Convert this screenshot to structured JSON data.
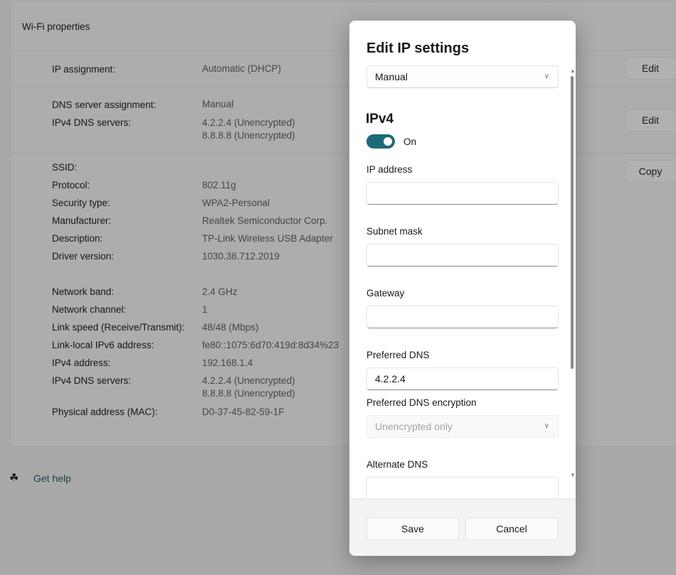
{
  "background": {
    "section_title": "Wi-Fi properties",
    "ip_assignment": {
      "label": "IP assignment:",
      "value": "Automatic (DHCP)",
      "button": "Edit"
    },
    "dns_assignment": {
      "label": "DNS server assignment:",
      "value": "Manual",
      "servers_label": "IPv4 DNS servers:",
      "servers": [
        "4.2.2.4 (Unencrypted)",
        "8.8.8.8 (Unencrypted)"
      ],
      "button": "Edit"
    },
    "copy_button": "Copy",
    "properties": [
      {
        "label": "SSID:",
        "value": ""
      },
      {
        "label": "Protocol:",
        "value": "802.11g"
      },
      {
        "label": "Security type:",
        "value": "WPA2-Personal"
      },
      {
        "label": "Manufacturer:",
        "value": "Realtek Semiconductor Corp."
      },
      {
        "label": "Description:",
        "value": "TP-Link Wireless USB Adapter"
      },
      {
        "label": "Driver version:",
        "value": "1030.38.712.2019"
      },
      {
        "label": "Network band:",
        "value": "2.4 GHz"
      },
      {
        "label": "Network channel:",
        "value": "1"
      },
      {
        "label": "Link speed (Receive/Transmit):",
        "value": "48/48 (Mbps)"
      },
      {
        "label": "Link-local IPv6 address:",
        "value": "fe80::1075:6d70:419d:8d34%23"
      },
      {
        "label": "IPv4 address:",
        "value": "192.168.1.4"
      },
      {
        "label": "IPv4 DNS servers:",
        "value": "4.2.2.4 (Unencrypted)",
        "value2": "8.8.8.8 (Unencrypted)"
      },
      {
        "label": "Physical address (MAC):",
        "value": "D0-37-45-82-59-1F"
      }
    ],
    "get_help": "Get help"
  },
  "dialog": {
    "title": "Edit IP settings",
    "mode_select": "Manual",
    "ipv4_heading": "IPv4",
    "ipv4_toggle": {
      "state": "On",
      "on": true,
      "color": "#1e6a78"
    },
    "fields": {
      "ip_address": {
        "label": "IP address",
        "value": ""
      },
      "subnet_mask": {
        "label": "Subnet mask",
        "value": ""
      },
      "gateway": {
        "label": "Gateway",
        "value": ""
      },
      "preferred_dns": {
        "label": "Preferred DNS",
        "value": "4.2.2.4"
      },
      "preferred_dns_encryption": {
        "label": "Preferred DNS encryption",
        "value": "Unencrypted only"
      },
      "alternate_dns": {
        "label": "Alternate DNS",
        "value": ""
      }
    },
    "save": "Save",
    "cancel": "Cancel"
  }
}
